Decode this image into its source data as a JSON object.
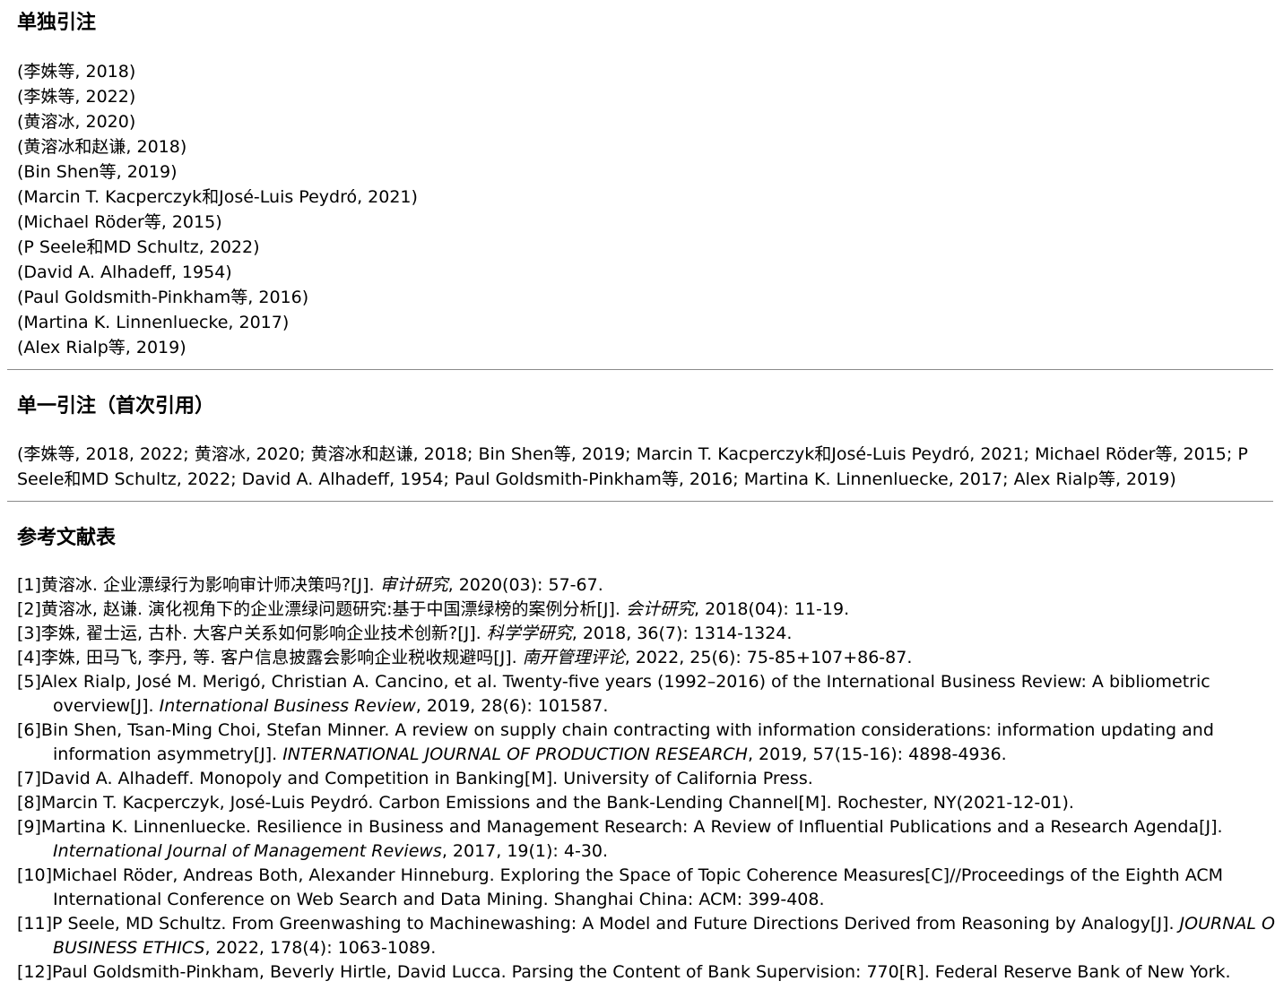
{
  "sections": {
    "single_title": "单独引注",
    "first_title": "单一引注（首次引用）",
    "references_title": "参考文献表"
  },
  "single_citations": [
    "(李姝等, 2018)",
    "(李姝等, 2022)",
    "(黄溶冰, 2020)",
    "(黄溶冰和赵谦, 2018)",
    "(Bin Shen等, 2019)",
    "(Marcin T. Kacperczyk和José-Luis Peydró, 2021)",
    "(Michael Röder等, 2015)",
    "(P Seele和MD Schultz, 2022)",
    "(David A. Alhadeff, 1954)",
    "(Paul Goldsmith-Pinkham等, 2016)",
    "(Martina K. Linnenluecke, 2017)",
    "(Alex Rialp等, 2019)"
  ],
  "combined_citation": "(李姝等, 2018, 2022; 黄溶冰, 2020; 黄溶冰和赵谦, 2018; Bin Shen等, 2019; Marcin T. Kacperczyk和José-Luis Peydró, 2021; Michael Röder等, 2015; P Seele和MD Schultz, 2022; David A. Alhadeff, 1954; Paul Goldsmith-Pinkham等, 2016; Martina K. Linnenluecke, 2017; Alex Rialp等, 2019)",
  "references": [
    {
      "pre": "[1]黄溶冰. 企业漂绿行为影响审计师决策吗?[J]. ",
      "journal": "审计研究",
      "post": ", 2020(03): 57-67."
    },
    {
      "pre": "[2]黄溶冰, 赵谦. 演化视角下的企业漂绿问题研究:基于中国漂绿榜的案例分析[J]. ",
      "journal": "会计研究",
      "post": ", 2018(04): 11-19."
    },
    {
      "pre": "[3]李姝, 翟士运, 古朴. 大客户关系如何影响企业技术创新?[J]. ",
      "journal": "科学学研究",
      "post": ", 2018, 36(7): 1314-1324."
    },
    {
      "pre": "[4]李姝, 田马飞, 李丹, 等. 客户信息披露会影响企业税收规避吗[J]. ",
      "journal": "南开管理评论",
      "post": ", 2022, 25(6): 75-85+107+86-87."
    },
    {
      "pre": "[5]Alex Rialp, José M. Merigó, Christian A. Cancino, et al. Twenty-five years (1992–2016) of the International Business Review: A bibliometric overview[J]. ",
      "journal": "International Business Review",
      "post": ", 2019, 28(6): 101587."
    },
    {
      "pre": "[6]Bin Shen, Tsan-Ming Choi, Stefan Minner. A review on supply chain contracting with information considerations: information updating and information asymmetry[J]. ",
      "journal": "INTERNATIONAL JOURNAL OF PRODUCTION RESEARCH",
      "post": ", 2019, 57(15-16): 4898-4936."
    },
    {
      "pre": "[7]David A. Alhadeff. Monopoly and Competition in Banking[M]. University of California Press.",
      "journal": "",
      "post": ""
    },
    {
      "pre": "[8]Marcin T. Kacperczyk, José-Luis Peydró. Carbon Emissions and the Bank-Lending Channel[M]. Rochester, NY(2021-12-01).",
      "journal": "",
      "post": ""
    },
    {
      "pre": "[9]Martina K. Linnenluecke. Resilience in Business and Management Research: A Review of Influential Publications and a Research Agenda[J]. ",
      "journal": "International Journal of Management Reviews",
      "post": ", 2017, 19(1): 4-30."
    },
    {
      "pre": "[10]Michael Röder, Andreas Both, Alexander Hinneburg. Exploring the Space of Topic Coherence Measures[C]//Proceedings of the Eighth ACM International Conference on Web Search and Data Mining. Shanghai China: ACM: 399-408.",
      "journal": "",
      "post": ""
    },
    {
      "pre": "[11]P Seele, MD Schultz. From Greenwashing to Machinewashing: A Model and Future Directions Derived from Reasoning by Analogy[J]. ",
      "journal": "JOURNAL OF BUSINESS ETHICS",
      "post": ", 2022, 178(4): 1063-1089."
    },
    {
      "pre": "[12]Paul Goldsmith-Pinkham, Beverly Hirtle, David Lucca. Parsing the Content of Bank Supervision: 770[R]. Federal Reserve Bank of New York.",
      "journal": "",
      "post": ""
    }
  ]
}
